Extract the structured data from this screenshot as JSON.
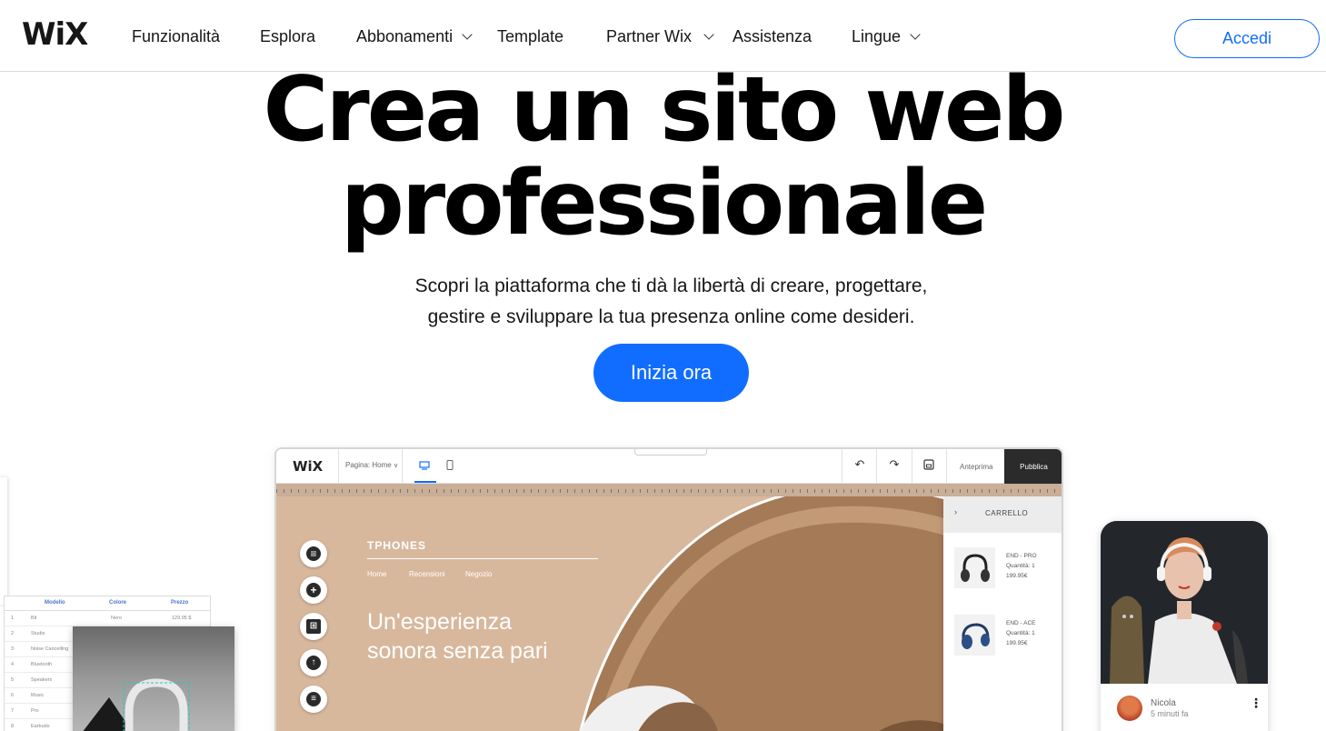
{
  "header": {
    "logo": "WiX",
    "nav": [
      {
        "label": "Funzionalità",
        "dropdown": false
      },
      {
        "label": "Esplora",
        "dropdown": false
      },
      {
        "label": "Abbonamenti",
        "dropdown": true
      },
      {
        "label": "Template",
        "dropdown": false
      },
      {
        "label": "Partner Wix",
        "dropdown": true
      },
      {
        "label": "Assistenza",
        "dropdown": false
      },
      {
        "label": "Lingue",
        "dropdown": true
      }
    ],
    "login_label": "Accedi"
  },
  "hero": {
    "title_line1": "Crea un sito web",
    "title_line2": "professionale",
    "subtitle_line1": "Scopri la piattaforma che ti dà la libertà di creare, progettare,",
    "subtitle_line2": "gestire e sviluppare la tua presenza online come desideri.",
    "cta_label": "Inizia ora"
  },
  "editor": {
    "logo": "WiX",
    "page_selector": "Pagina: Home",
    "preview_label": "Anteprima",
    "publish_label": "Pubblica",
    "site": {
      "brand": "TPHONES",
      "nav": [
        "Home",
        "Recensioni",
        "Negozio"
      ],
      "headline_line1": "Un'esperienza",
      "headline_line2": "sonora senza pari"
    },
    "cart": {
      "title": "CARRELLO",
      "items": [
        {
          "name": "END - PRO",
          "qty": "Quantità: 1",
          "price": "199.95€"
        },
        {
          "name": "END - ACE",
          "qty": "Quantità: 1",
          "price": "199.95€"
        }
      ]
    }
  },
  "table_mock": {
    "headers": [
      "Modello",
      "Colore",
      "Prezzo"
    ],
    "rows": [
      {
        "n": "1",
        "model": "Bit",
        "color": "Nero",
        "price": "129.95 $"
      },
      {
        "n": "2",
        "model": "Studio",
        "color": "",
        "price": ""
      },
      {
        "n": "3",
        "model": "Noise Cancelling",
        "color": "",
        "price": ""
      },
      {
        "n": "4",
        "model": "Bluetooth",
        "color": "",
        "price": ""
      },
      {
        "n": "5",
        "model": "Speakers",
        "color": "",
        "price": ""
      },
      {
        "n": "6",
        "model": "Music",
        "color": "",
        "price": ""
      },
      {
        "n": "7",
        "model": "Pro",
        "color": "",
        "price": ""
      },
      {
        "n": "8",
        "model": "Earbuds",
        "color": "",
        "price": ""
      }
    ]
  },
  "phone": {
    "user_name": "Nicola",
    "time": "5 minuti fa"
  },
  "colors": {
    "accent": "#116dff",
    "canvas": "#d8b89d",
    "publish_bg": "#2b2b2b"
  }
}
